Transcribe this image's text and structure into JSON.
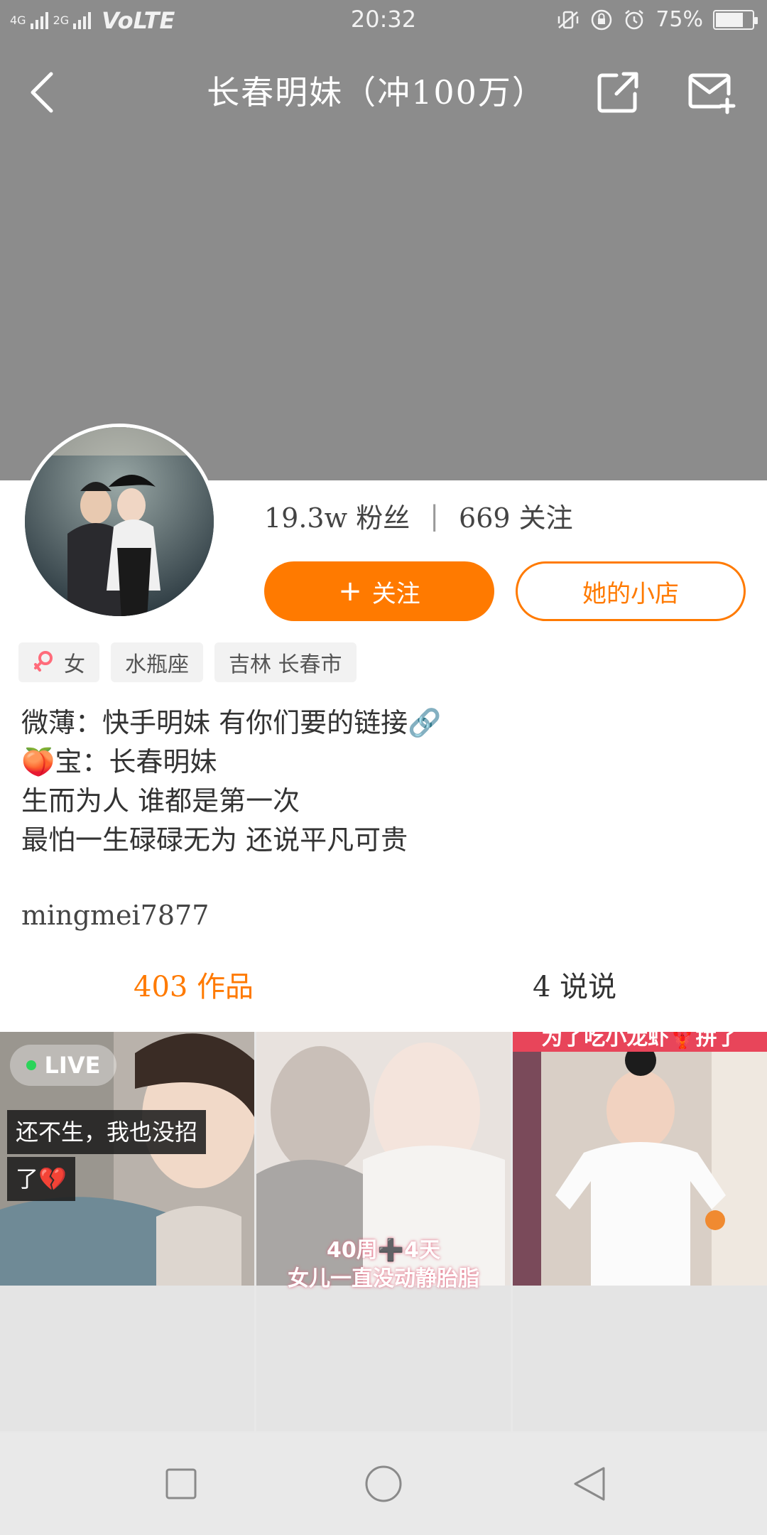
{
  "status_bar": {
    "network_1": "4G",
    "network_2": "2G",
    "volte": "VoLTE",
    "time": "20:32",
    "battery_text": "75%",
    "battery_level": 0.75
  },
  "header": {
    "title": "长春明妹（冲100万）"
  },
  "profile": {
    "fans": "19.3w 粉丝",
    "following": "669 关注",
    "follow_label": "关注",
    "shop_label": "她的小店"
  },
  "tags": [
    {
      "label": "女",
      "icon": "female-icon"
    },
    {
      "label": "水瓶座"
    },
    {
      "label": "吉林 长春市"
    }
  ],
  "bio": {
    "line1": "微薄：快手明妹  有你们要的链接🔗",
    "line2_text": "宝：长春明妹",
    "line2_emoji": "🍑",
    "line3": "生而为人 谁都是第一次",
    "line4": "最怕一生碌碌无为 还说平凡可贵"
  },
  "username": "mingmei7877",
  "tabs": {
    "works": "403 作品",
    "posts": "4 说说"
  },
  "grid": {
    "item1": {
      "live": "LIVE",
      "caption_line1": "还不生，我也没招",
      "caption_line2": "了💔"
    },
    "item2": {
      "overlay_line1": "40周➕4天",
      "overlay_line2": "女儿一直没动静胎脂"
    },
    "item3": {
      "overlay_top": "为了吃小龙虾🦞拼了"
    }
  },
  "colors": {
    "accent": "#ff7a00",
    "header_bg": "#8c8c8c"
  }
}
